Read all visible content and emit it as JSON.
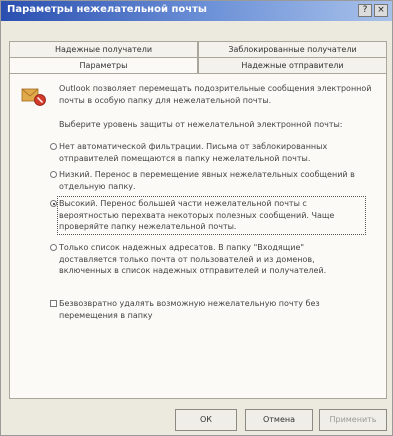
{
  "window": {
    "title": "Параметры нежелательной почты",
    "buttons": {
      "help": "?",
      "close": "×"
    }
  },
  "tabs": {
    "row1": [
      "Надежные получатели",
      "Заблокированные получатели"
    ],
    "row2": [
      "Параметры",
      "Надежные отправители"
    ],
    "active": "Параметры"
  },
  "content": {
    "description": "Outlook позволяет перемещать подозрительные сообщения электронной почты в особую папку для нежелательной почты.",
    "level_label": "Выберите уровень защиты от нежелательной электронной почты:",
    "options": [
      {
        "label": "Нет автоматической фильтрации. Письма от заблокированных отправителей помещаются в папку нежелательной почты.",
        "selected": false
      },
      {
        "label": "Низкий. Перенос в перемещение явных нежелательных сообщений в отдельную папку.",
        "selected": false
      },
      {
        "label": "Высокий. Перенос большей части нежелательной почты с вероятностью перехвата некоторых полезных сообщений. Чаще проверяйте папку нежелательной почты.",
        "selected": true
      },
      {
        "label": "Только список надежных адресатов. В папку \"Входящие\" доставляется только почта от пользователей и из доменов, включенных в список надежных отправителей и получателей.",
        "selected": false
      }
    ],
    "checkbox": {
      "label": "Безвозвратно удалять возможную нежелательную почту без перемещения в папку",
      "checked": false
    }
  },
  "footer": {
    "ok": "ОК",
    "cancel": "Отмена",
    "apply": "Применить"
  },
  "colors": {
    "title_bar_start": "#2a4fb0",
    "title_bar_end": "#a9c2ea",
    "warning_icon": "#e0a94a"
  }
}
